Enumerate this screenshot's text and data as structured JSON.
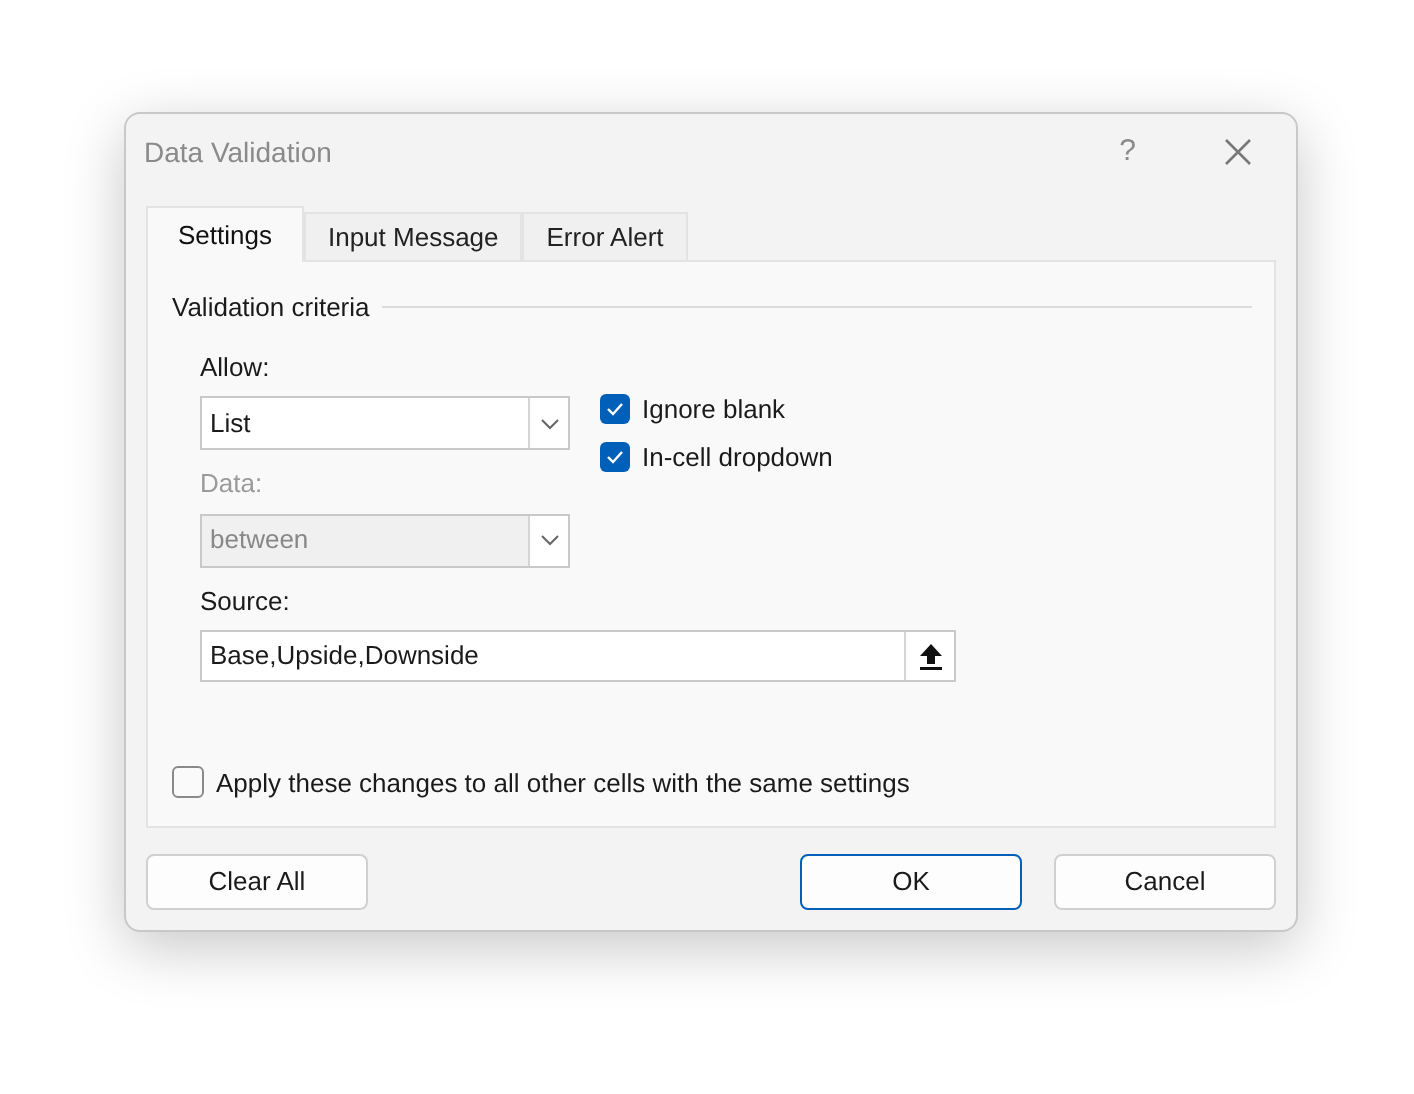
{
  "window": {
    "title": "Data Validation",
    "help": "?"
  },
  "tabs": [
    {
      "label": "Settings",
      "selected": true
    },
    {
      "label": "Input Message",
      "selected": false
    },
    {
      "label": "Error Alert",
      "selected": false
    }
  ],
  "group": {
    "title": "Validation criteria"
  },
  "allow": {
    "label": "Allow:",
    "value": "List",
    "disabled": false
  },
  "data": {
    "label": "Data:",
    "value": "between",
    "disabled": true
  },
  "options": [
    {
      "label": "Ignore blank",
      "checked": true
    },
    {
      "label": "In-cell dropdown",
      "checked": true
    }
  ],
  "source": {
    "label": "Source:",
    "value": "Base,Upside,Downside"
  },
  "apply_all": {
    "label": "Apply these changes to all other cells with the same settings",
    "checked": false
  },
  "buttons": [
    {
      "label": "Clear All",
      "kind": "secondary"
    },
    {
      "label": "OK",
      "kind": "default"
    },
    {
      "label": "Cancel",
      "kind": "secondary"
    }
  ]
}
